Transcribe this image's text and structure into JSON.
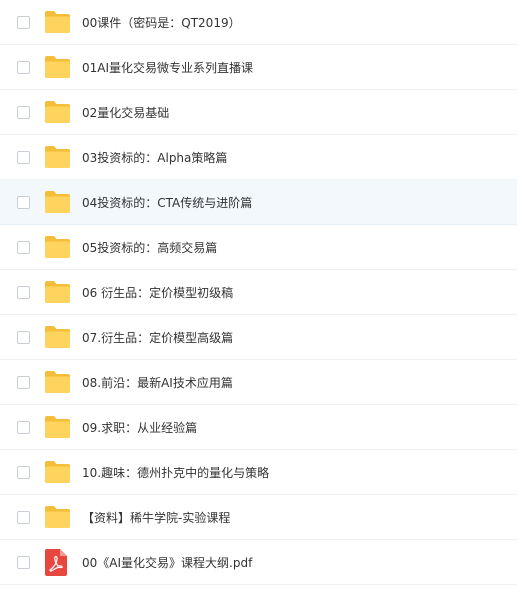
{
  "files": [
    {
      "name": "00课件（密码是：QT2019）",
      "type": "folder",
      "icon": "folder-icon"
    },
    {
      "name": "01AI量化交易微专业系列直播课",
      "type": "folder",
      "icon": "folder-icon"
    },
    {
      "name": "02量化交易基础",
      "type": "folder",
      "icon": "folder-icon"
    },
    {
      "name": "03投资标的：Alpha策略篇",
      "type": "folder",
      "icon": "folder-icon"
    },
    {
      "name": "04投资标的：CTA传统与进阶篇",
      "type": "folder",
      "icon": "folder-icon",
      "hovered": true
    },
    {
      "name": "05投资标的：高频交易篇",
      "type": "folder",
      "icon": "folder-icon"
    },
    {
      "name": "06 衍生品：定价模型初级稿",
      "type": "folder",
      "icon": "folder-icon"
    },
    {
      "name": "07.衍生品：定价模型高级篇",
      "type": "folder",
      "icon": "folder-icon"
    },
    {
      "name": "08.前沿：最新AI技术应用篇",
      "type": "folder",
      "icon": "folder-icon"
    },
    {
      "name": "09.求职：从业经验篇",
      "type": "folder",
      "icon": "folder-icon"
    },
    {
      "name": "10.趣味：德州扑克中的量化与策略",
      "type": "folder",
      "icon": "folder-icon"
    },
    {
      "name": "【资料】稀牛学院-实验课程",
      "type": "folder",
      "icon": "folder-icon"
    },
    {
      "name": "00《AI量化交易》课程大纲.pdf",
      "type": "pdf",
      "icon": "pdf-icon"
    }
  ],
  "colors": {
    "folder_front": "#FFD45E",
    "folder_back": "#F5BE3A",
    "pdf_red": "#E8473F",
    "hover_bg": "#F3F8FD"
  }
}
